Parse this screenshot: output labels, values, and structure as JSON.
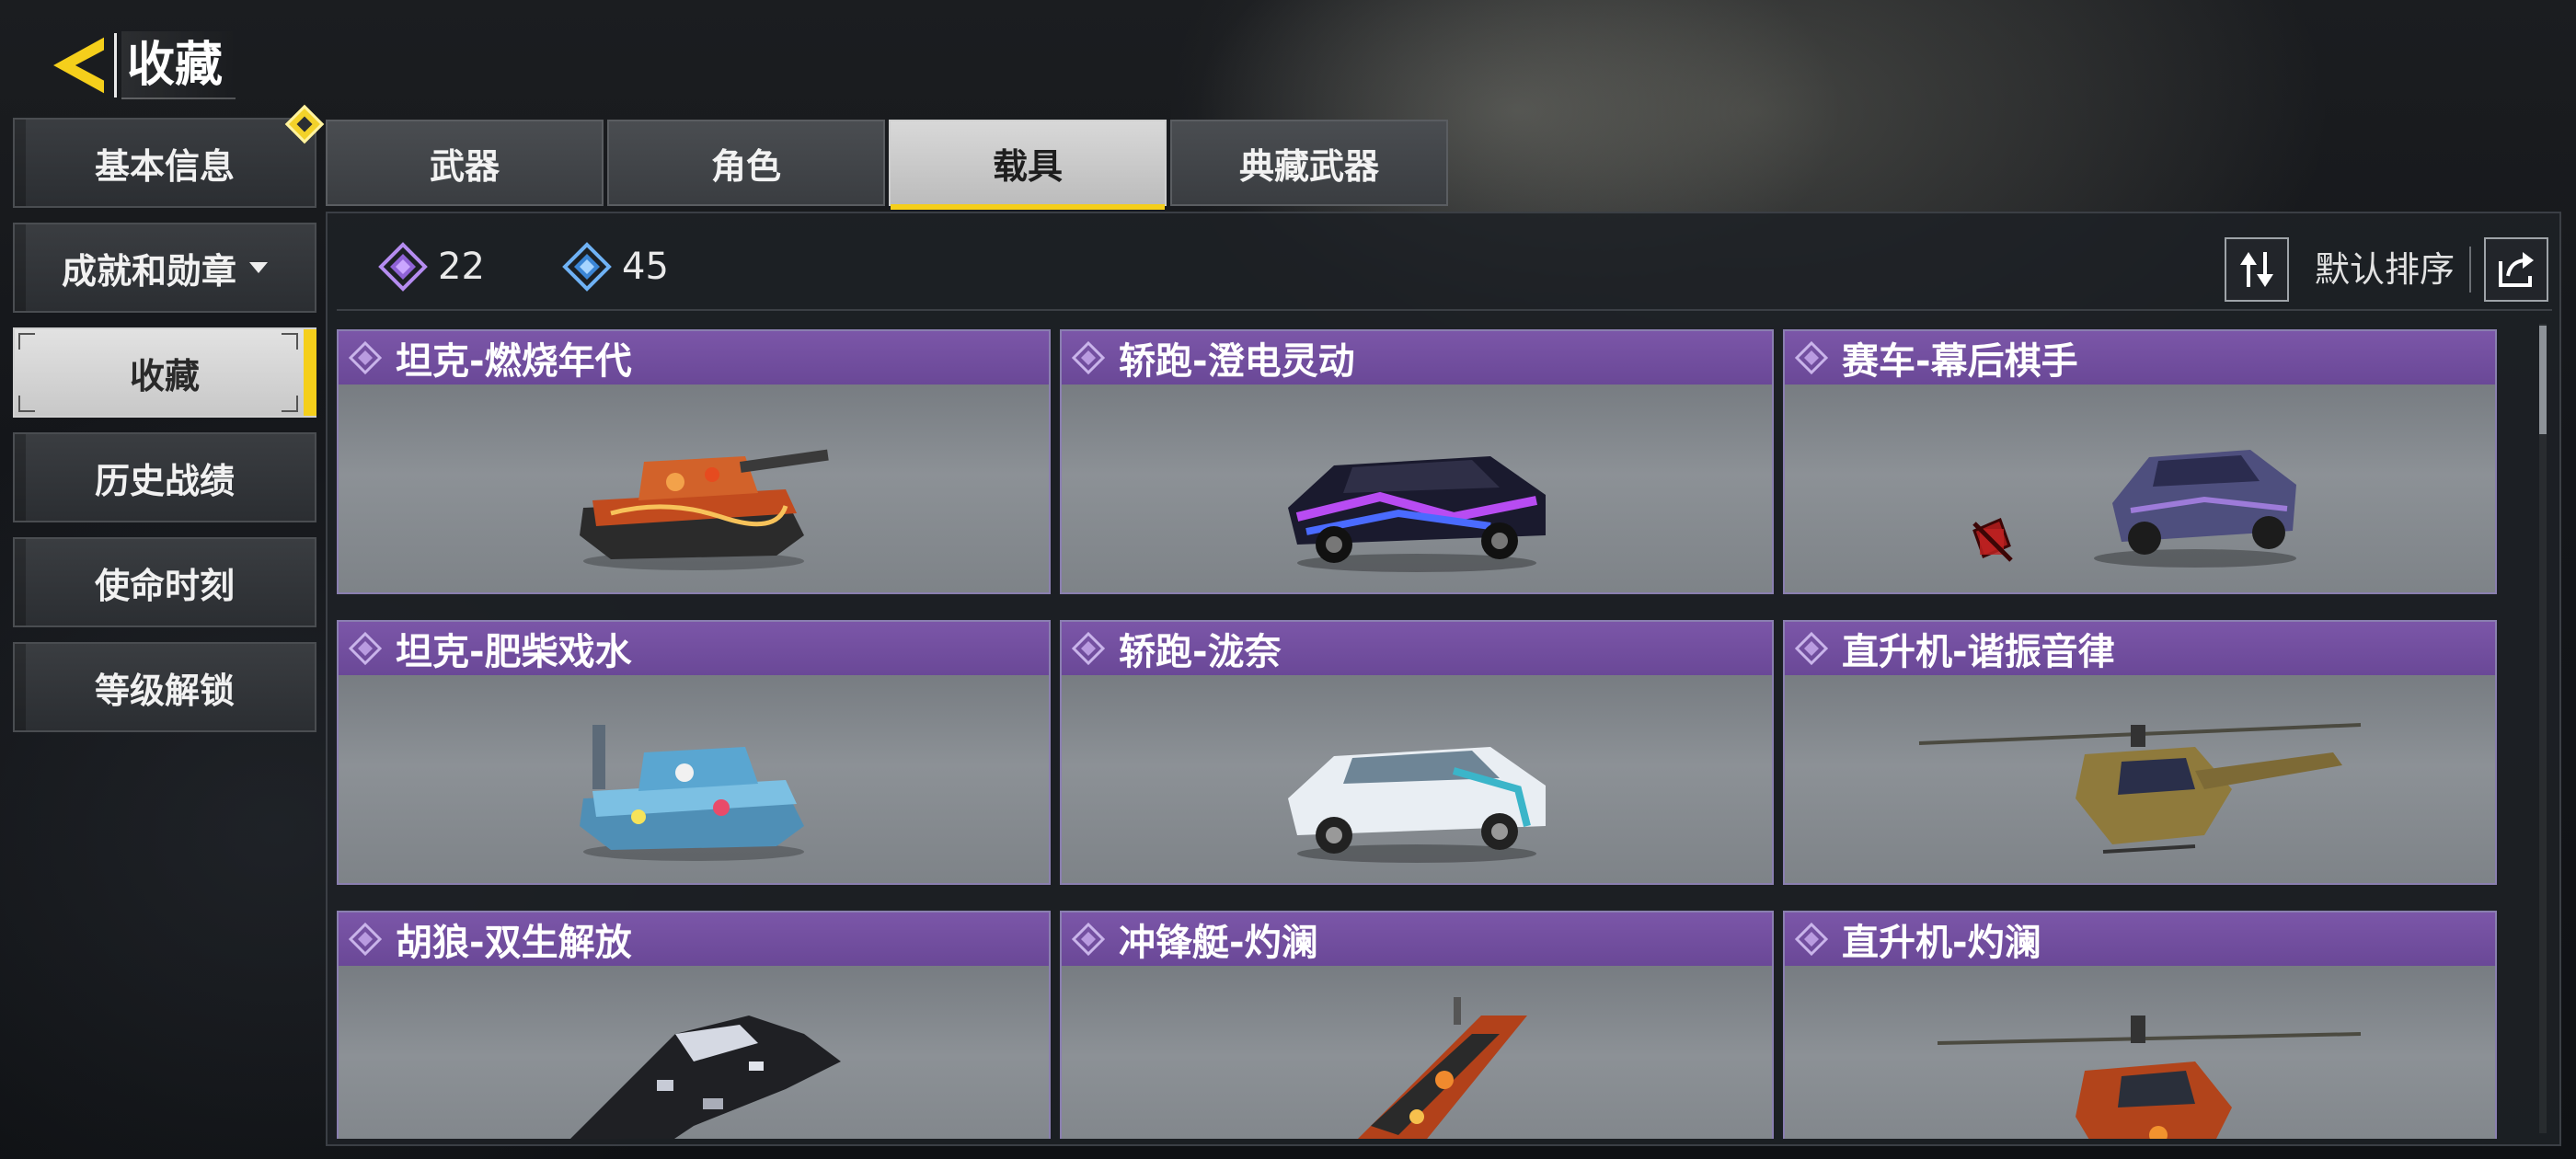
{
  "header": {
    "title": "收藏",
    "back_icon": "back-arrow-icon"
  },
  "sidebar": {
    "items": [
      {
        "label": "基本信息",
        "has_badge": true
      },
      {
        "label": "成就和勋章",
        "has_dropdown": true
      },
      {
        "label": "收藏",
        "active": true
      },
      {
        "label": "历史战绩"
      },
      {
        "label": "使命时刻"
      },
      {
        "label": "等级解锁"
      }
    ]
  },
  "tabs": [
    {
      "label": "武器"
    },
    {
      "label": "角色"
    },
    {
      "label": "载具",
      "active": true
    },
    {
      "label": "典藏武器"
    }
  ],
  "toolbar": {
    "purple_count": "22",
    "blue_count": "45",
    "sort_label": "默认排序"
  },
  "cards": [
    {
      "title": "坦克-燃烧年代",
      "vehicle": "tank",
      "skin": "fire"
    },
    {
      "title": "轿跑-澄电灵动",
      "vehicle": "coupe",
      "skin": "neon"
    },
    {
      "title": "赛车-幕后棋手",
      "vehicle": "sedan",
      "skin": "violet",
      "locked_icon": true
    },
    {
      "title": "坦克-肥柴戏水",
      "vehicle": "tank",
      "skin": "blue"
    },
    {
      "title": "轿跑-泷奈",
      "vehicle": "coupe",
      "skin": "white"
    },
    {
      "title": "直升机-谐振音律",
      "vehicle": "helicopter",
      "skin": "olive"
    },
    {
      "title": "胡狼-双生解放",
      "vehicle": "jackal",
      "skin": "camo"
    },
    {
      "title": "冲锋艇-灼澜",
      "vehicle": "boat",
      "skin": "lava"
    },
    {
      "title": "直升机-灼澜",
      "vehicle": "helicopter",
      "skin": "lava"
    }
  ],
  "colors": {
    "accent_yellow": "#f5cf1b",
    "card_title_purple": "#7b56a8",
    "purple_rarity": "#b58cf0",
    "blue_rarity": "#6fb2f5"
  }
}
